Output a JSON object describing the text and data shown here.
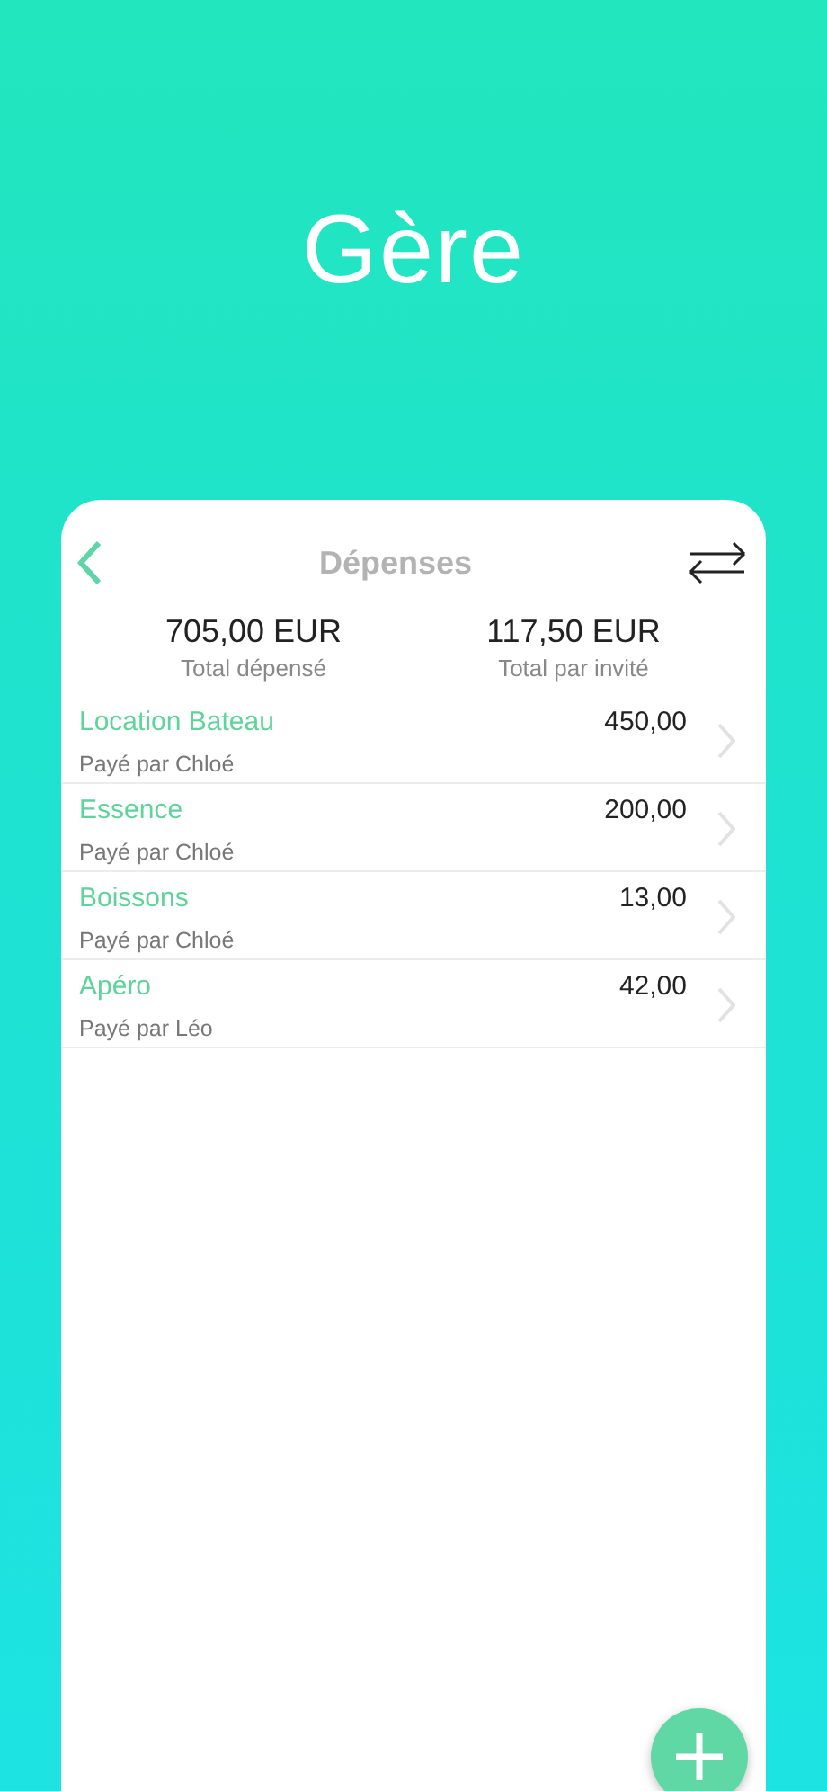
{
  "headline": "Gère",
  "nav": {
    "title": "Dépenses"
  },
  "totals": [
    {
      "amount": "705,00 EUR",
      "label": "Total dépensé"
    },
    {
      "amount": "117,50 EUR",
      "label": "Total par invité"
    }
  ],
  "expenses": [
    {
      "name": "Location Bateau",
      "amount": "450,00",
      "payer": "Payé par Chloé"
    },
    {
      "name": "Essence",
      "amount": "200,00",
      "payer": "Payé par Chloé"
    },
    {
      "name": "Boissons",
      "amount": "13,00",
      "payer": "Payé par Chloé"
    },
    {
      "name": "Apéro",
      "amount": "42,00",
      "payer": "Payé par Léo"
    }
  ]
}
